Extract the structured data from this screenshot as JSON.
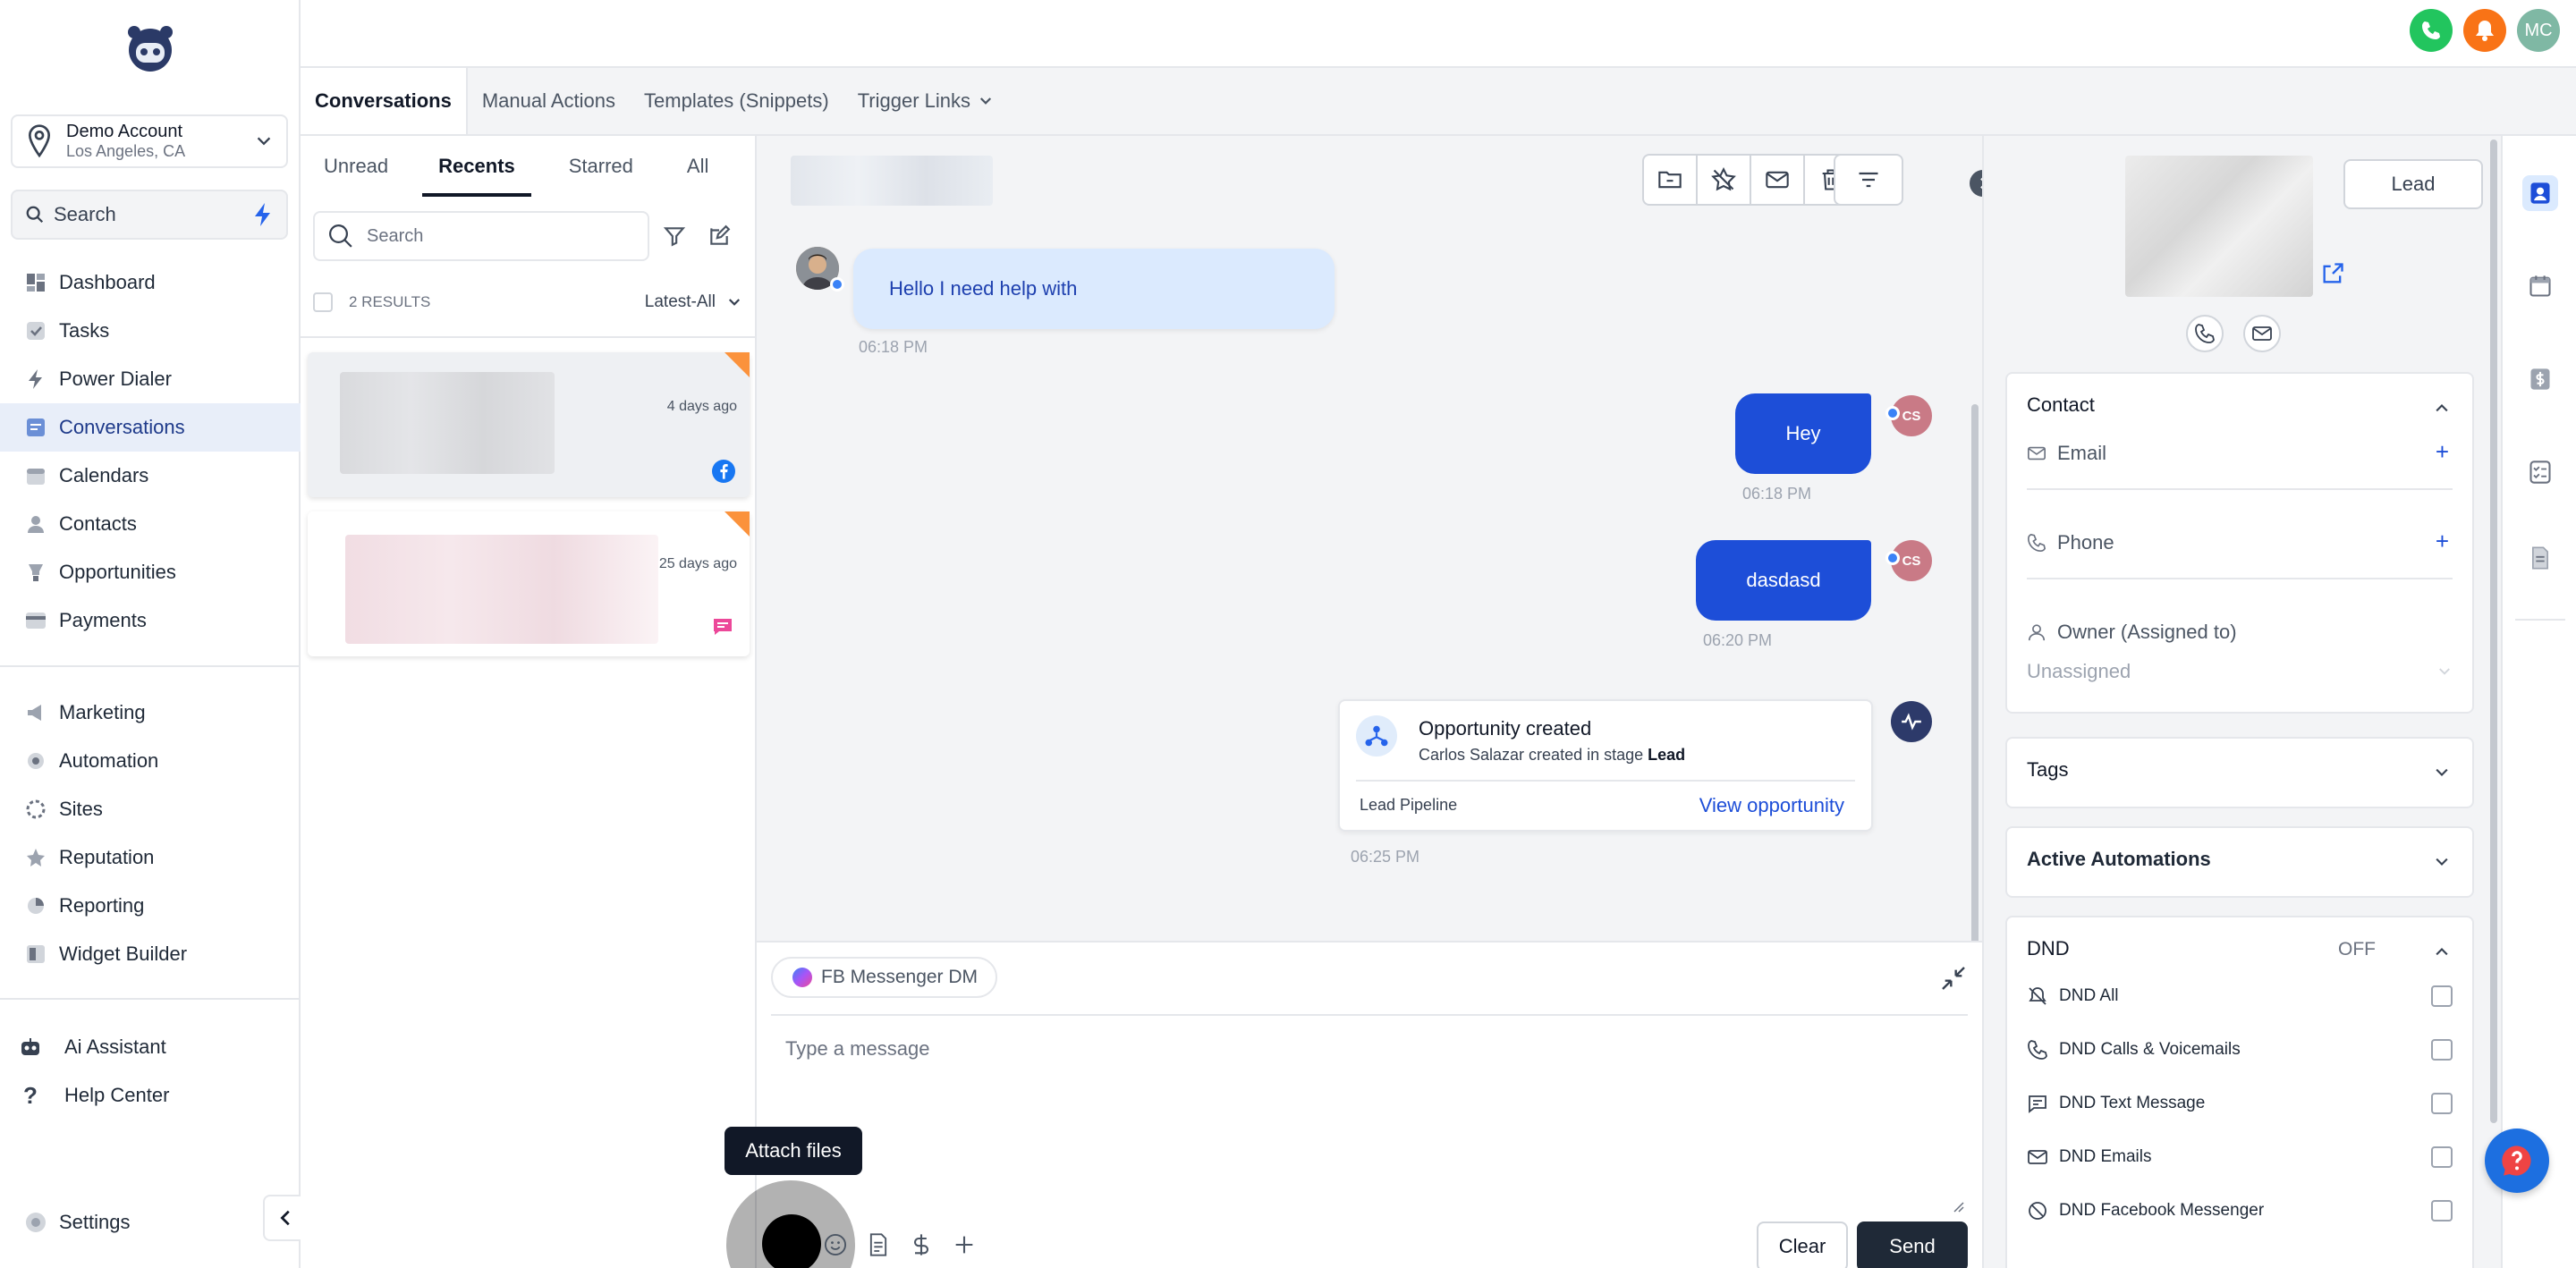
{
  "sidebar": {
    "account": {
      "name": "Demo Account",
      "location": "Los Angeles, CA"
    },
    "search": {
      "label": "Search"
    },
    "nav_primary": [
      {
        "label": "Dashboard",
        "icon": "dashboard-icon"
      },
      {
        "label": "Tasks",
        "icon": "check-icon"
      },
      {
        "label": "Power Dialer",
        "icon": "bolt-icon"
      },
      {
        "label": "Conversations",
        "icon": "chat-icon",
        "active": true
      },
      {
        "label": "Calendars",
        "icon": "calendar-icon"
      },
      {
        "label": "Contacts",
        "icon": "person-icon"
      },
      {
        "label": "Opportunities",
        "icon": "trophy-icon"
      },
      {
        "label": "Payments",
        "icon": "card-icon"
      }
    ],
    "nav_secondary": [
      {
        "label": "Marketing",
        "icon": "megaphone-icon"
      },
      {
        "label": "Automation",
        "icon": "gear-icon"
      },
      {
        "label": "Sites",
        "icon": "globe-icon"
      },
      {
        "label": "Reputation",
        "icon": "star-icon"
      },
      {
        "label": "Reporting",
        "icon": "chart-icon"
      },
      {
        "label": "Widget Builder",
        "icon": "widget-icon"
      }
    ],
    "nav_bottom": [
      {
        "label": "Ai Assistant",
        "icon": "robot-icon"
      },
      {
        "label": "Help Center",
        "icon": "question-icon"
      }
    ],
    "settings_label": "Settings"
  },
  "topbar": {
    "avatar_initials": "MC",
    "colors": {
      "phone": "#22c55e",
      "bell": "#f97316",
      "avatar": "#7fb8a4"
    }
  },
  "main_tabs": [
    {
      "label": "Conversations",
      "active": true
    },
    {
      "label": "Manual Actions"
    },
    {
      "label": "Templates (Snippets)"
    },
    {
      "label": "Trigger Links"
    }
  ],
  "list": {
    "tabs": [
      {
        "label": "Unread"
      },
      {
        "label": "Recents",
        "active": true
      },
      {
        "label": "Starred"
      },
      {
        "label": "All"
      }
    ],
    "search_placeholder": "Search",
    "results_label": "2 RESULTS",
    "sort_label": "Latest-All",
    "items": [
      {
        "time": "4 days ago",
        "channel_icon": "facebook-icon"
      },
      {
        "time": "25 days ago",
        "channel_icon": "sms-icon"
      }
    ]
  },
  "chat": {
    "messages": [
      {
        "direction": "in",
        "text": "Hello I need help with",
        "time": "06:18 PM"
      },
      {
        "direction": "out",
        "text": "Hey",
        "time": "06:18 PM",
        "avatar": "CS"
      },
      {
        "direction": "out",
        "text": "dasdasd",
        "time": "06:20 PM",
        "avatar": "CS"
      }
    ],
    "activity": {
      "title": "Opportunity created",
      "sub_prefix": "Carlos Salazar created in stage",
      "stage": "Lead",
      "pipeline": "Lead Pipeline",
      "link": "View opportunity",
      "time": "06:25 PM"
    },
    "composer": {
      "channel": "FB Messenger DM",
      "placeholder": "Type a message",
      "tooltip": "Attach files",
      "clear_label": "Clear",
      "send_label": "Send"
    }
  },
  "contact": {
    "lead_label": "Lead",
    "contact_header": "Contact",
    "email_label": "Email",
    "phone_label": "Phone",
    "owner_label": "Owner (Assigned to)",
    "owner_value": "Unassigned",
    "tags_header": "Tags",
    "automations_header": "Active Automations",
    "dnd_header": "DND",
    "dnd_status": "OFF",
    "dnd_items": [
      {
        "label": "DND All",
        "icon": "bell-off-icon"
      },
      {
        "label": "DND Calls & Voicemails",
        "icon": "phone-icon"
      },
      {
        "label": "DND Text Message",
        "icon": "message-icon"
      },
      {
        "label": "DND Emails",
        "icon": "mail-icon"
      },
      {
        "label": "DND Facebook Messenger",
        "icon": "block-icon"
      }
    ]
  }
}
